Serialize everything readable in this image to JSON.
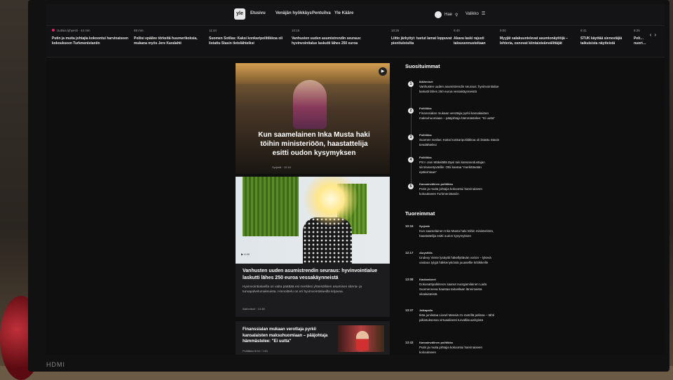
{
  "header": {
    "logo": "yle",
    "nav": [
      "Etusivu",
      "Venäjän hyökkäys",
      "Pentuilva",
      "Yle Kääre"
    ],
    "search_label": "Hae",
    "menu_label": "Valikko"
  },
  "ticker": [
    {
      "time": "Uutisia lyhyesti · 44 min",
      "text": "Putin ja muita johtajia kokoontui harvinaiseen kokoukseen Turkmenistaniin"
    },
    {
      "time": "59 min",
      "text": "Poliisi epäilee törkeitä huumerikoksia, mukana myös Jere Karalahti"
    },
    {
      "time": "11:44",
      "text": "Suomen Sotilas: Kaksi konkaripoliitikkoa oli listattu Stasin tietolähteiksi"
    },
    {
      "time": "10:16",
      "text": "Vanhusten uuden asumistrendin seuraus: hyvinvointialue laskutti lähes 250 euroa"
    },
    {
      "time": "10:25",
      "text": "Liitto järkyttyi: tuetut lamat loppuvat pienituloisilta"
    },
    {
      "time": "9:40",
      "text": "Akava laski rajusti talousennusteitaan"
    },
    {
      "time": "9:00",
      "text": "Myyjät salakuuntelevat asumtonäyttöjä – lehteria, osnovat kiintaisteänvälittäjät"
    },
    {
      "time": "8:41",
      "text": "STUK käyttää sienestäjiä taikuisista näytteistä"
    },
    {
      "time": "8:25",
      "text": "Pelt… nuort…"
    }
  ],
  "hero": {
    "title": "Kun saamelainen Inka Musta haki töihin ministeriöön, haastattelija esitti oudon kysymyksen",
    "meta": "Syrjintä · 10:16"
  },
  "article2": {
    "video_duration": "4:40",
    "title": "Vanhusten uuden asumistrendin seuraus: hyvinvointialue laskutti lähes 250 euroa vessakäynneistä",
    "lead": "Hyvinvointialueilla on valta päättää esi merkiksi yhteisöllisen asumisen siteria- ja turvapalvelumaksuista. Hinnoittelu on eri hyvinvointialueilla kirjavaa.",
    "meta": "Ikäihmiset · 10:38"
  },
  "article3": {
    "title": "Finanssialan mukaan verottaja pyrkii kansalaisten maksuhuomiaan – pääjohtaja hämmästelee: \"Ei uutta\"",
    "category": "Politiikka",
    "time": "8:04",
    "comments": "161"
  },
  "popular": {
    "title": "Suosituimmat",
    "items": [
      {
        "num": "1",
        "cat": "Ikäihmiset",
        "text": "Vanhusten uuden asumistrendin seuraus: hyvinvointialue laskutti lähes 250 euroa vessakäynneistä"
      },
      {
        "num": "2",
        "cat": "Politiikka",
        "text": "Finanssialan mukaan verottaja pyrkii kansalaisten maksuhuomiaan – pääjohtaja hämmästelee: \"Ei uutta\""
      },
      {
        "num": "3",
        "cat": "Politiikka",
        "text": "Suomen Sotilas: Kaksi konkaripoliitikkoa oli listattu Stasin tietolähteiksi"
      },
      {
        "num": "4",
        "cat": "Politiikka",
        "text": "PS:n Jani Mäkelältä täysi tuki kansanedustajan siirolaisvetyvärille: Ottii kantaa \"merkittävään epäkohtaan\""
      },
      {
        "num": "5",
        "cat": "Kansainvälinen politiikka",
        "text": "Putin ja muita johtajia kokoontui harvinaiseen kokoukseen Turkmenistaniin"
      }
    ]
  },
  "latest": {
    "title": "Tuoreimmat",
    "items": [
      {
        "time": "10:16",
        "cat": "Syrjintä",
        "text": "Kun saamelainen Inka Musta haki töihin ministeriöön, haastattelija esitti oudon kysymyksen"
      },
      {
        "time": "12:17",
        "cat": "Aloysfiilis",
        "text": "Undexy Viene lysäyttii häkellyttävän vorion – lykevä vastaus tylyjä häkkenyköisiä juuasellie kritiikkeille"
      },
      {
        "time": "13:08",
        "cat": "Kaukoalueet",
        "text": "Dokusattipalkinnon saanut nuorgamilainen Lada Suomenneva haastaa taitoellaan lännimaista sikalaisteistä"
      },
      {
        "time": "13:37",
        "cat": "Jalkapallo",
        "text": "Iktta junilistaa Lionel Messiä 21-metrillä pelissa – tähti julkistuksessa virtuaalisesti turvalliisuuslsyistä"
      },
      {
        "time": "13:43",
        "cat": "Kansainvälinen politiikka",
        "text": "Putin ja muita johtajia kokoontui harvinaiseen kokoukseen"
      }
    ]
  },
  "monitor_label": "HDMI"
}
